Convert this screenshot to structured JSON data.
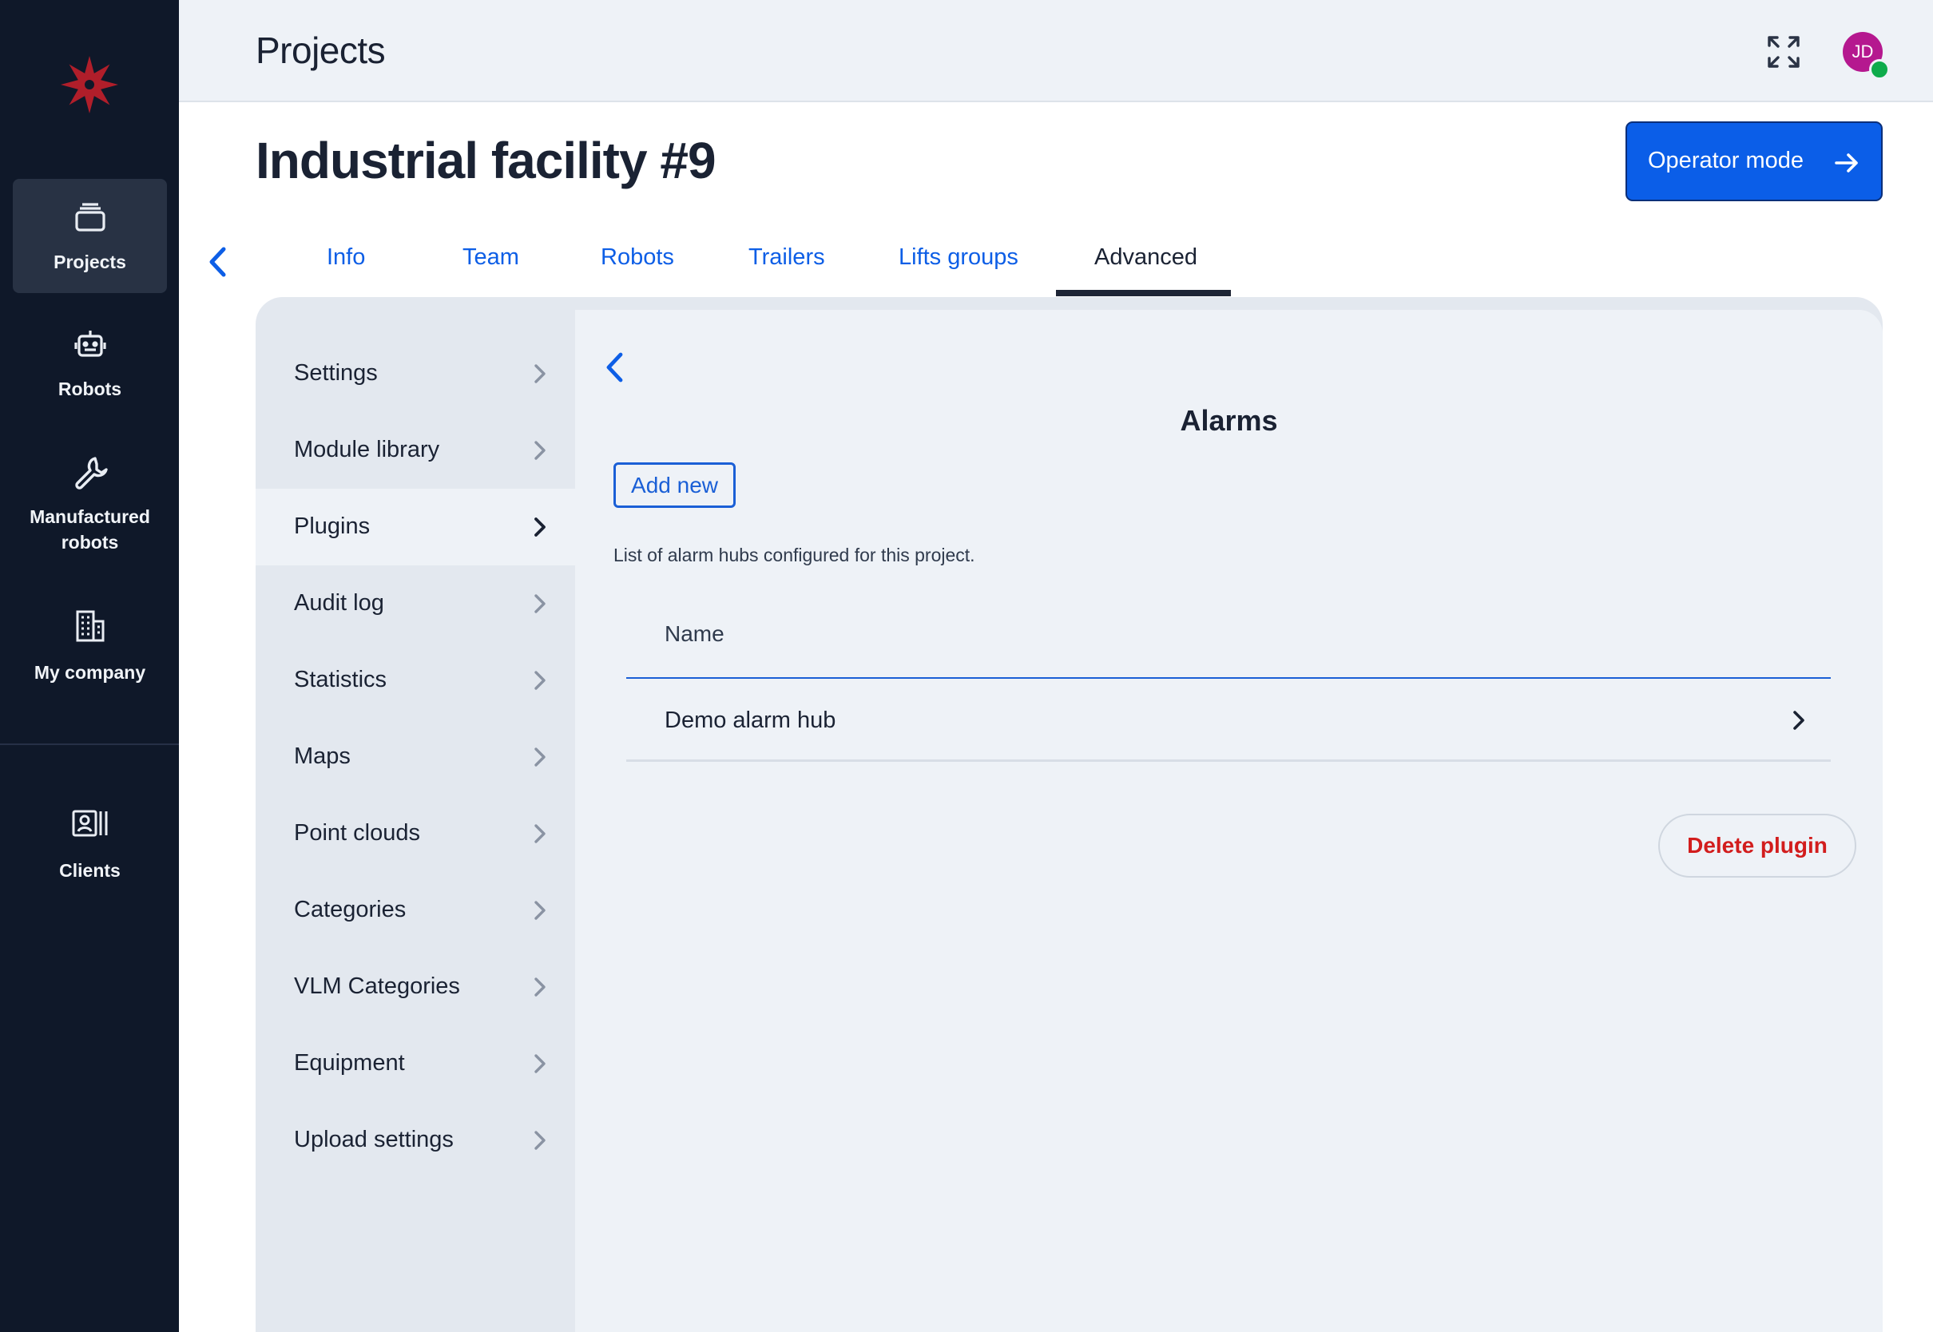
{
  "app": {
    "logo": "snowflake-logo"
  },
  "nav": {
    "items": [
      {
        "label": "Projects",
        "icon": "folder-stack-icon",
        "active": true
      },
      {
        "label": "Robots",
        "icon": "robot-icon",
        "active": false
      },
      {
        "label": "Manufactured robots",
        "icon": "wrench-icon",
        "active": false
      },
      {
        "label": "My company",
        "icon": "building-icon",
        "active": false
      },
      {
        "label": "Clients",
        "icon": "contacts-icon",
        "active": false
      }
    ]
  },
  "topbar": {
    "title": "Projects",
    "avatar_initials": "JD",
    "avatar_color": "#b5188f",
    "status_color": "#0dab4b"
  },
  "header": {
    "title": "Industrial facility #9",
    "operator_button": "Operator mode"
  },
  "tabs": [
    {
      "label": "Info",
      "active": false
    },
    {
      "label": "Team",
      "active": false
    },
    {
      "label": "Robots",
      "active": false
    },
    {
      "label": "Trailers",
      "active": false
    },
    {
      "label": "Lifts groups",
      "active": false
    },
    {
      "label": "Advanced",
      "active": true
    }
  ],
  "submenu": {
    "items": [
      {
        "label": "Settings",
        "selected": false
      },
      {
        "label": "Module library",
        "selected": false
      },
      {
        "label": "Plugins",
        "selected": true
      },
      {
        "label": "Audit log",
        "selected": false
      },
      {
        "label": "Statistics",
        "selected": false
      },
      {
        "label": "Maps",
        "selected": false
      },
      {
        "label": "Point clouds",
        "selected": false
      },
      {
        "label": "Categories",
        "selected": false
      },
      {
        "label": "VLM Categories",
        "selected": false
      },
      {
        "label": "Equipment",
        "selected": false
      },
      {
        "label": "Upload settings",
        "selected": false
      }
    ]
  },
  "alarms": {
    "title": "Alarms",
    "add_button": "Add new",
    "description": "List of alarm hubs configured for this project.",
    "column_header": "Name",
    "rows": [
      {
        "name": "Demo alarm hub"
      }
    ],
    "delete_button": "Delete plugin"
  },
  "colors": {
    "accent": "#0b5ee8",
    "sidebar_bg": "#0f1829",
    "danger": "#d21d1d"
  }
}
